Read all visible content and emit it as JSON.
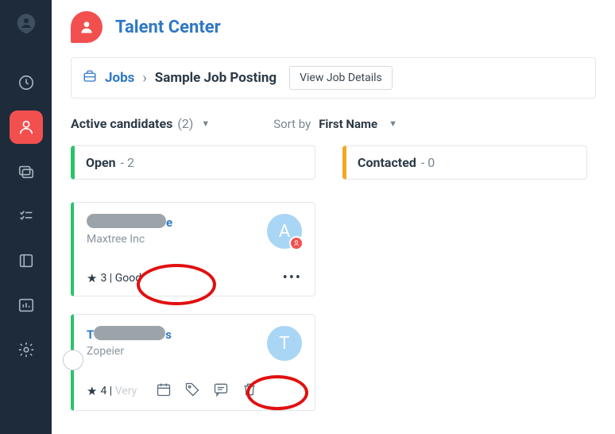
{
  "header": {
    "title": "Talent Center"
  },
  "breadcrumb": {
    "jobs_label": "Jobs",
    "separator": "›",
    "current": "Sample Job Posting",
    "view_button": "View Job Details"
  },
  "controls": {
    "active_label": "Active candidates",
    "active_count": "(2)",
    "sort_label": "Sort by",
    "sort_value": "First Name"
  },
  "columns": {
    "open": {
      "status": "Open",
      "count": "- 2"
    },
    "contacted": {
      "status": "Contacted",
      "count": "- 0"
    }
  },
  "cards": [
    {
      "name_suffix": "e",
      "company": "Maxtree Inc",
      "avatar_letter": "A",
      "rating_value": "3",
      "rating_text": "Good",
      "assigned": true
    },
    {
      "name_suffix": "s",
      "company": "Zopeier",
      "avatar_letter": "T",
      "rating_value": "4",
      "rating_text": "Very",
      "assigned": false
    }
  ]
}
